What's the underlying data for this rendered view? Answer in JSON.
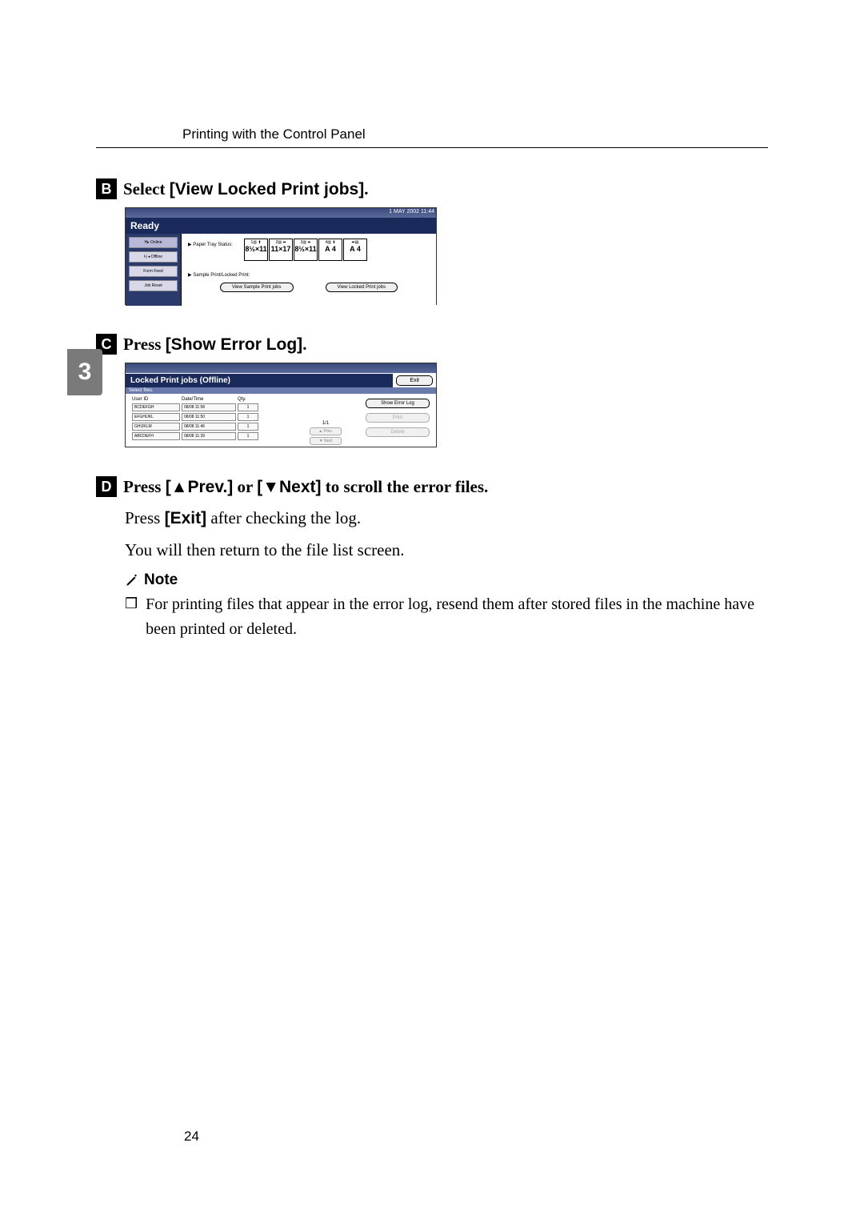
{
  "header": {
    "title": "Printing with the Control Panel"
  },
  "sideTab": "3",
  "pageNumber": "24",
  "step2": {
    "verb": "Select ",
    "ui": "[View Locked Print jobs]",
    "end": "."
  },
  "ss1": {
    "tb_right": "1 MAY 2002  11:44",
    "ready": "Ready",
    "side": {
      "online": "H▸ Online",
      "offline": "I┤◂ Offline",
      "formfeed": "Form Feed",
      "jobreset": "Job Reset"
    },
    "paperTray": "▶ Paper Tray Status:",
    "trays": [
      {
        "top": "1▥ ⬍",
        "big": "8½×11"
      },
      {
        "top": "2▤ ⬌",
        "big": "11×17"
      },
      {
        "top": "3▥ ⬌",
        "big": "8½×11"
      },
      {
        "top": "4▥ ⬍",
        "big": "A 4"
      },
      {
        "top": "⬌▤",
        "big": "A 4"
      }
    ],
    "smlabel": "▶ Sample Print/Locked Print:",
    "vbtn1": "View Sample Print jobs",
    "vbtn2": "View Locked Print jobs"
  },
  "step3": {
    "verb": "Press ",
    "ui": "[Show Error Log]",
    "end": "."
  },
  "ss2": {
    "title": "Locked Print jobs (Offline)",
    "exit": "Exit",
    "sub": "Select files.",
    "th": {
      "c1": "User ID",
      "c2": "Date/Time",
      "c3": "Qty."
    },
    "rows": [
      {
        "c1": "BCDEFGH",
        "c2": " 08/08  11:58",
        "c3": "1"
      },
      {
        "c1": "EFGHIJKL",
        "c2": " 08/08  11:50",
        "c3": "1"
      },
      {
        "c1": "GHIJKLM",
        "c2": " 08/08  11:46",
        "c3": "1"
      },
      {
        "c1": "ABCDEFH",
        "c2": " 08/08  11:39",
        "c3": "1"
      }
    ],
    "page": "1/1",
    "prev": "▲ Prev.",
    "next": "▼ Next",
    "showErr": "Show Error Log",
    "print": "Print",
    "delete": "Delete"
  },
  "step4": {
    "verb": "Press ",
    "ui1": "[▲Prev.]",
    "mid": " or ",
    "ui2": "[▼Next]",
    "end": " to scroll the error files."
  },
  "body": {
    "line1a": "Press ",
    "line1u": "[Exit]",
    "line1b": " after checking the log.",
    "line2": "You will then return to the file list screen."
  },
  "note": {
    "label": "Note",
    "text": "For printing files that appear in the error log, resend them after stored files in the machine have been printed or deleted."
  }
}
